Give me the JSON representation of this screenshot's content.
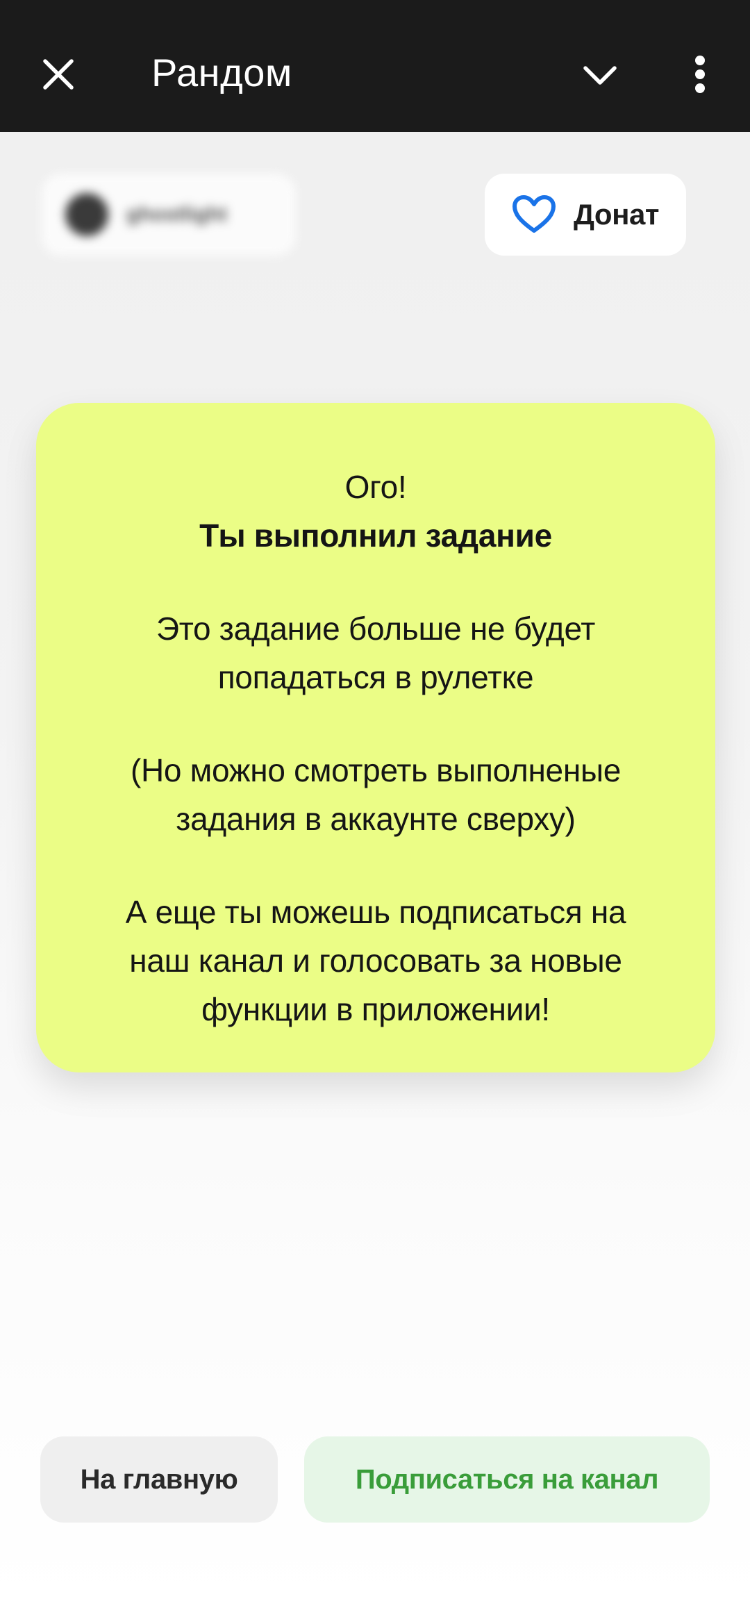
{
  "header": {
    "title": "Рандом",
    "close_icon": "close-icon",
    "dropdown_icon": "chevron-down-icon",
    "menu_icon": "more-vertical-icon"
  },
  "profile": {
    "username": "ghostlight"
  },
  "donate": {
    "label": "Донат",
    "icon": "heart-icon",
    "icon_color": "#1a73e8"
  },
  "card": {
    "background": "#ebfd86",
    "line1": "Ого!",
    "line2": "Ты выполнил задание",
    "line3": "Это задание больше не будет",
    "line4": "попадаться в рулетке",
    "line5": "(Но можно смотреть выполненые",
    "line6": "задания в аккаунте сверху)",
    "line7": "А еще ты можешь подписаться на",
    "line8": "наш канал и голосовать за новые",
    "line9": "функции в приложении!"
  },
  "actions": {
    "home_label": "На главную",
    "subscribe_label": "Подписаться на канал",
    "subscribe_color": "#3a9d3a"
  }
}
